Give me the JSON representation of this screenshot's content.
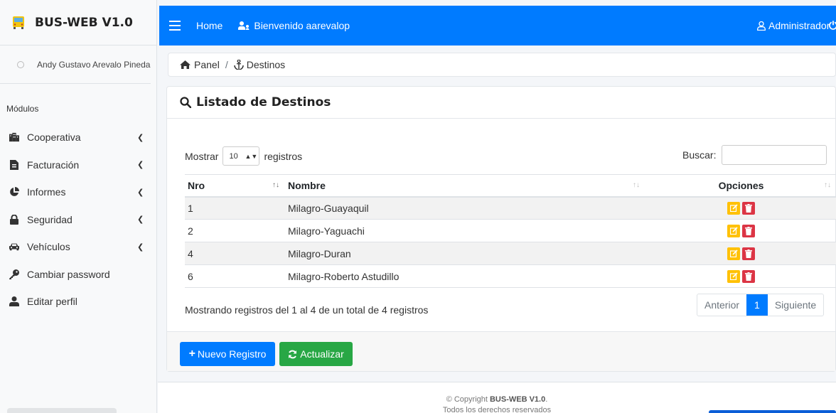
{
  "brand": {
    "title": "BUS-WEB V1.0"
  },
  "user": {
    "name": "Andy Gustavo Arevalo Pineda"
  },
  "sidebar": {
    "section_label": "Módulos",
    "items": [
      {
        "label": "Cooperativa",
        "icon": "building-icon",
        "expandable": true
      },
      {
        "label": "Facturación",
        "icon": "invoice-icon",
        "expandable": true
      },
      {
        "label": "Informes",
        "icon": "pie-chart-icon",
        "expandable": true
      },
      {
        "label": "Seguridad",
        "icon": "lock-icon",
        "expandable": true
      },
      {
        "label": "Vehículos",
        "icon": "car-icon",
        "expandable": true
      },
      {
        "label": "Cambiar password",
        "icon": "key-icon",
        "expandable": false
      },
      {
        "label": "Editar perfil",
        "icon": "user-icon",
        "expandable": false
      }
    ]
  },
  "topbar": {
    "home": "Home",
    "welcome": "Bienvenido aarevalop",
    "admin": "Administrador"
  },
  "breadcrumb": {
    "panel": "Panel",
    "separator": "/",
    "current": "Destinos"
  },
  "card": {
    "title": "Listado de Destinos"
  },
  "table_controls": {
    "show_label": "Mostrar",
    "page_size": "10",
    "records_label": "registros",
    "search_label": "Buscar:",
    "search_value": ""
  },
  "table": {
    "headers": {
      "nro": "Nro",
      "nombre": "Nombre",
      "opciones": "Opciones"
    },
    "rows": [
      {
        "nro": "1",
        "nombre": "Milagro-Guayaquil"
      },
      {
        "nro": "2",
        "nombre": "Milagro-Yaguachi"
      },
      {
        "nro": "4",
        "nombre": "Milagro-Duran"
      },
      {
        "nro": "6",
        "nombre": "Milagro-Roberto Astudillo"
      }
    ]
  },
  "pagination": {
    "info": "Mostrando registros del 1 al 4 de un total de 4 registros",
    "prev": "Anterior",
    "current": "1",
    "next": "Siguiente"
  },
  "actions": {
    "new": "Nuevo Registro",
    "refresh": "Actualizar"
  },
  "footer": {
    "copyright_prefix": "© Copyright ",
    "copyright_brand": "BUS-WEB V1.0",
    "copyright_suffix": ".",
    "rights": "Todos los derechos reservados"
  },
  "colors": {
    "primary": "#007bff",
    "success": "#28a745",
    "warning": "#ffc107",
    "danger": "#dc3545"
  }
}
